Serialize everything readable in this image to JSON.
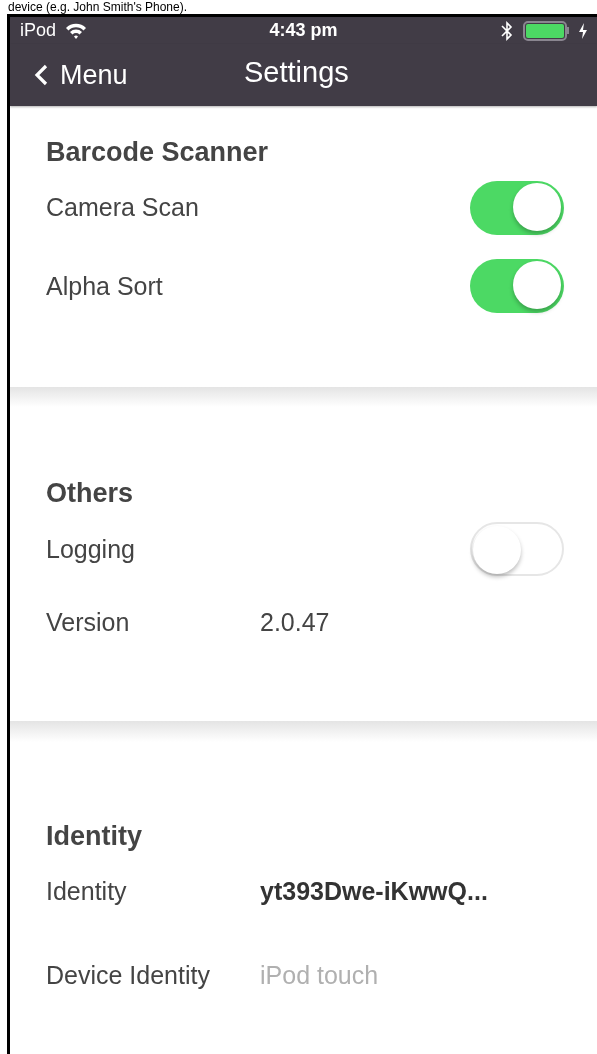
{
  "caption": "device (e.g. John Smith's Phone).",
  "status_bar": {
    "carrier": "iPod",
    "time": "4:43 pm"
  },
  "nav_bar": {
    "back": "Menu",
    "title": "Settings"
  },
  "sections": [
    {
      "title": "Barcode Scanner",
      "rows": [
        {
          "kind": "toggle",
          "label": "Camera Scan",
          "on": true
        },
        {
          "kind": "toggle",
          "label": "Alpha Sort",
          "on": true
        }
      ]
    },
    {
      "title": "Others",
      "rows": [
        {
          "kind": "toggle",
          "label": "Logging",
          "on": false
        },
        {
          "kind": "value",
          "label": "Version",
          "value": "2.0.47"
        }
      ]
    },
    {
      "title": "Identity",
      "rows": [
        {
          "kind": "value",
          "label": "Identity",
          "value": "yt393Dwe-iKwwQ...",
          "emphasis": true
        },
        {
          "kind": "field",
          "label": "Device Identity",
          "placeholder": "iPod touch"
        }
      ]
    }
  ]
}
